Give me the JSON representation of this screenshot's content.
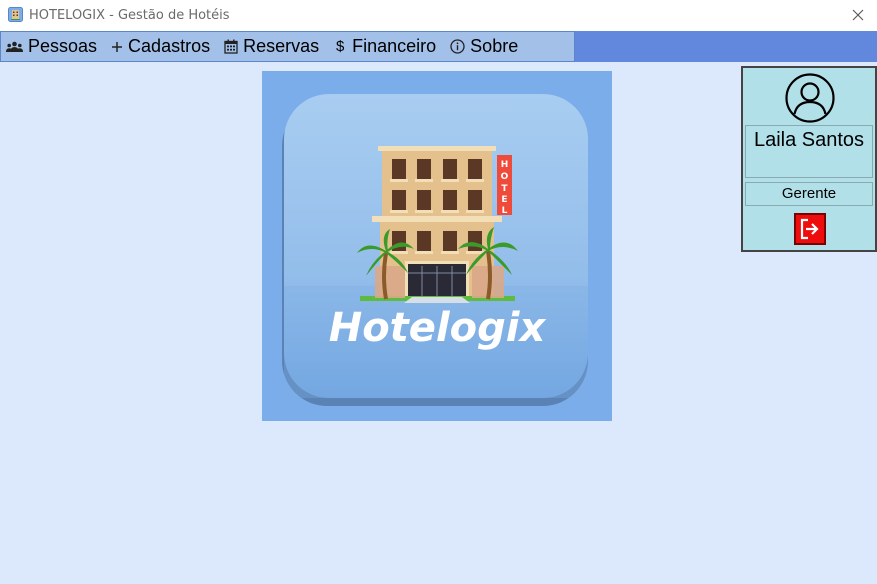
{
  "window": {
    "title": "HOTELOGIX - Gestão de Hotéis",
    "app_icon": "hotel-app-icon",
    "close_icon": "close-icon"
  },
  "menu": {
    "items": [
      {
        "label": "Pessoas",
        "icon": "people-icon"
      },
      {
        "label": "Cadastros",
        "icon": "plus-icon"
      },
      {
        "label": "Reservas",
        "icon": "calendar-icon"
      },
      {
        "label": "Financeiro",
        "icon": "dollar-icon"
      },
      {
        "label": "Sobre",
        "icon": "info-icon"
      }
    ]
  },
  "logo": {
    "brand_text": "Hotelogix",
    "sign_text": "HOTEL"
  },
  "user": {
    "name": "Laila Santos",
    "role": "Gerente",
    "avatar_icon": "user-avatar-icon",
    "logout_icon": "logout-icon"
  },
  "colors": {
    "background": "#dce8fb",
    "menubar_accent": "#6288dd",
    "menubar": "#a3c0e8",
    "user_panel": "#b1e0e9",
    "logout": "#ee0d0d"
  }
}
